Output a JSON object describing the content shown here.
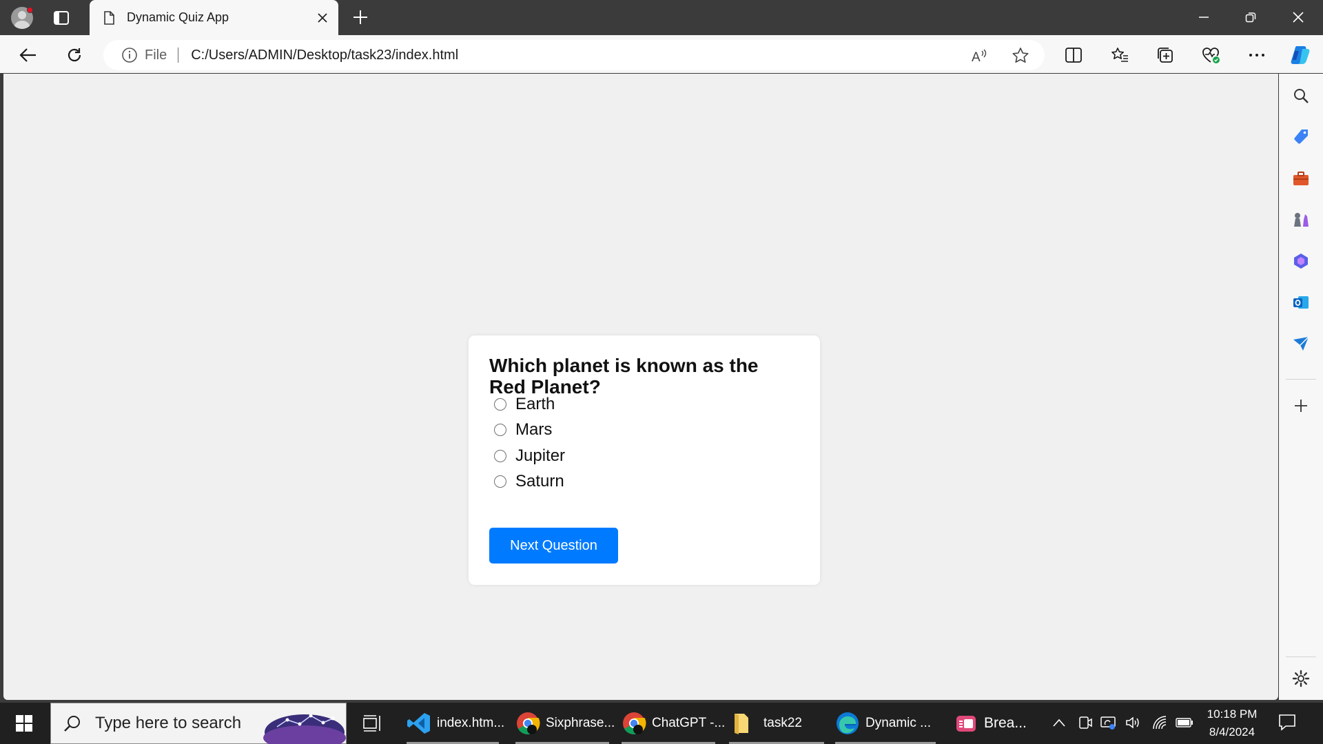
{
  "browser": {
    "tab": {
      "title": "Dynamic Quiz App"
    },
    "address": {
      "scheme_label": "File",
      "url": "C:/Users/ADMIN/Desktop/task23/index.html"
    }
  },
  "quiz": {
    "question": "Which planet is known as the Red Planet?",
    "options": [
      {
        "label": "Earth",
        "selected": false
      },
      {
        "label": "Mars",
        "selected": false
      },
      {
        "label": "Jupiter",
        "selected": false
      },
      {
        "label": "Saturn",
        "selected": false
      }
    ],
    "next_button": "Next Question",
    "accent_color": "#007bff"
  },
  "taskbar": {
    "search_placeholder": "Type here to search",
    "apps": [
      {
        "label": "index.htm...",
        "icon": "vscode-icon"
      },
      {
        "label": "Sixphrase...",
        "icon": "chrome-icon"
      },
      {
        "label": "ChatGPT -...",
        "icon": "chrome-icon"
      },
      {
        "label": "task22",
        "icon": "folder-icon"
      },
      {
        "label": "Dynamic ...",
        "icon": "edge-icon"
      },
      {
        "label": "Brea...",
        "icon": "app-icon"
      }
    ],
    "clock": {
      "time": "10:18 PM",
      "date": "8/4/2024"
    }
  }
}
